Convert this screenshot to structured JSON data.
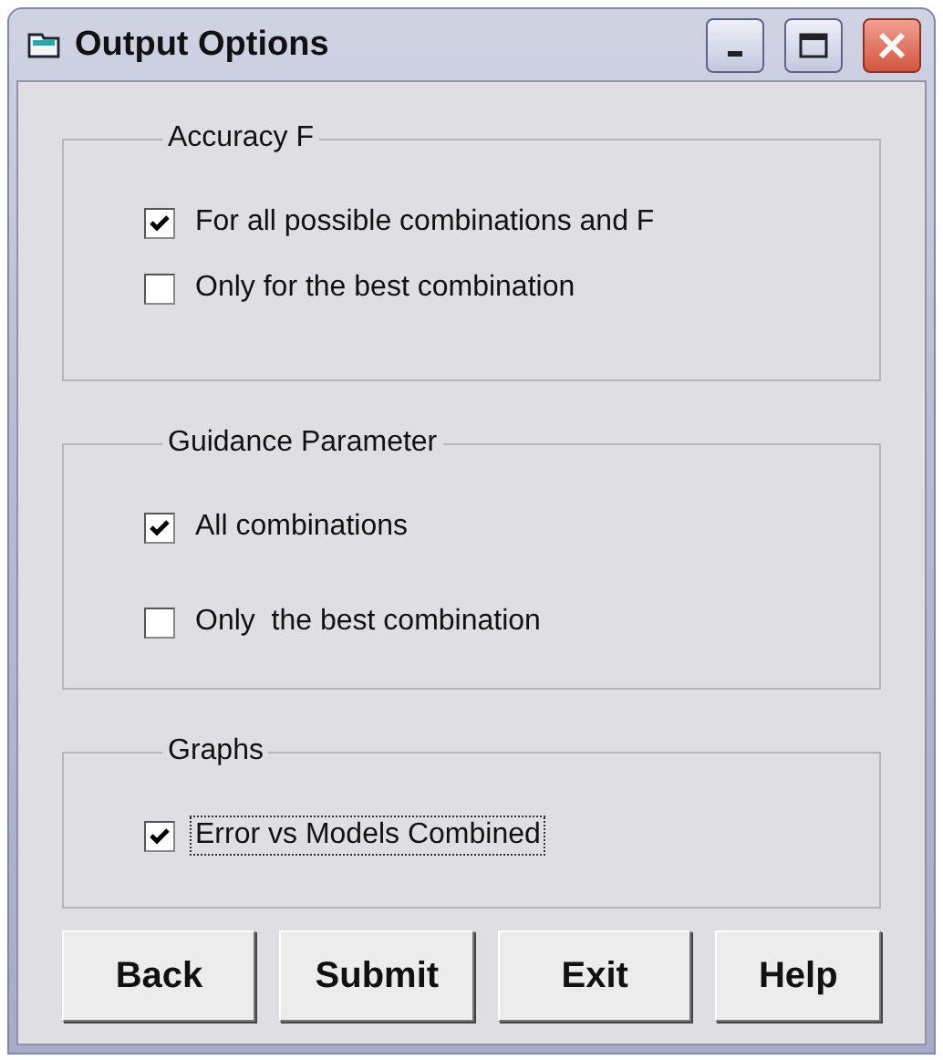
{
  "window": {
    "title": "Output Options"
  },
  "groups": [
    {
      "title": "Accuracy F",
      "options": [
        {
          "label": "For all possible combinations and F",
          "checked": true,
          "focused": false
        },
        {
          "label": "Only for the best combination",
          "checked": false,
          "focused": false
        }
      ]
    },
    {
      "title": "Guidance Parameter",
      "options": [
        {
          "label": "All combinations",
          "checked": true,
          "focused": false
        },
        {
          "label": "Only  the best combination",
          "checked": false,
          "focused": false
        }
      ]
    },
    {
      "title": "Graphs",
      "options": [
        {
          "label": "Error vs Models Combined",
          "checked": true,
          "focused": true
        }
      ]
    }
  ],
  "buttons": [
    "Back",
    "Submit",
    "Exit",
    "Help"
  ]
}
